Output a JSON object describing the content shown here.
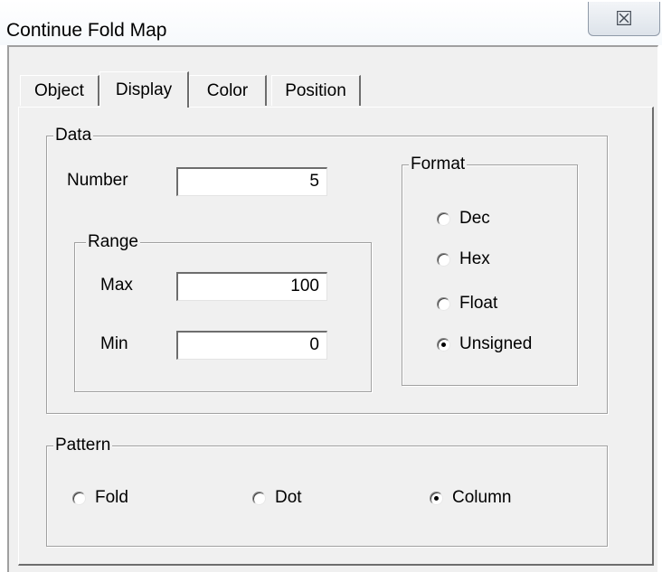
{
  "window": {
    "title": "Continue Fold Map",
    "close_glyph": "☒"
  },
  "tabs": [
    {
      "label": "Object"
    },
    {
      "label": "Display",
      "active": true
    },
    {
      "label": "Color"
    },
    {
      "label": "Position"
    }
  ],
  "data_group": {
    "label": "Data",
    "number_label": "Number",
    "number_value": "5",
    "range": {
      "label": "Range",
      "max_label": "Max",
      "max_value": "100",
      "min_label": "Min",
      "min_value": "0"
    },
    "format": {
      "label": "Format",
      "options": [
        "Dec",
        "Hex",
        "Float",
        "Unsigned"
      ],
      "selected": "Unsigned"
    }
  },
  "pattern_group": {
    "label": "Pattern",
    "options": [
      "Fold",
      "Dot",
      "Column"
    ],
    "selected": "Column"
  }
}
